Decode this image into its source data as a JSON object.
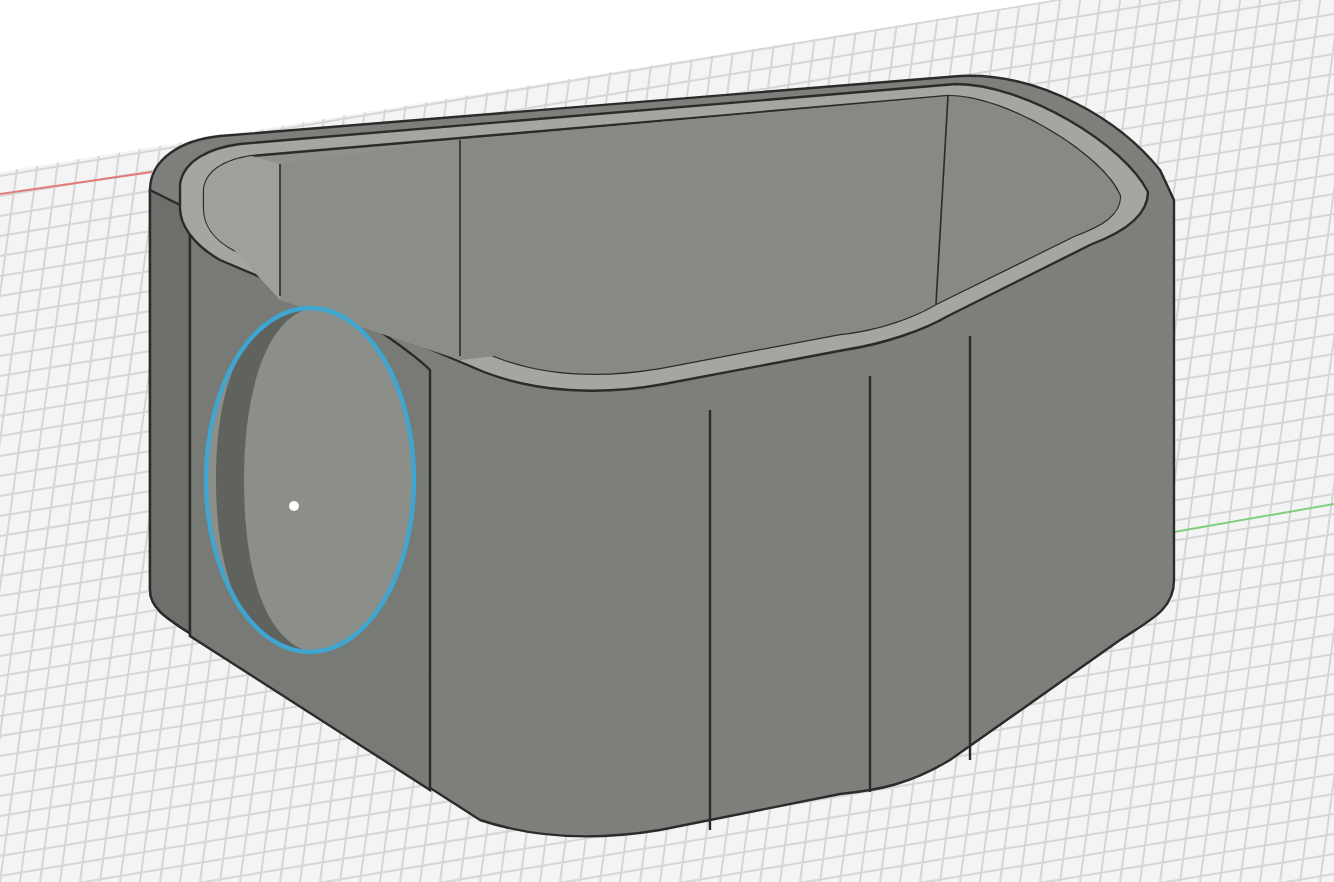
{
  "viewport": {
    "grid": true,
    "hole_edge_selected": true
  }
}
